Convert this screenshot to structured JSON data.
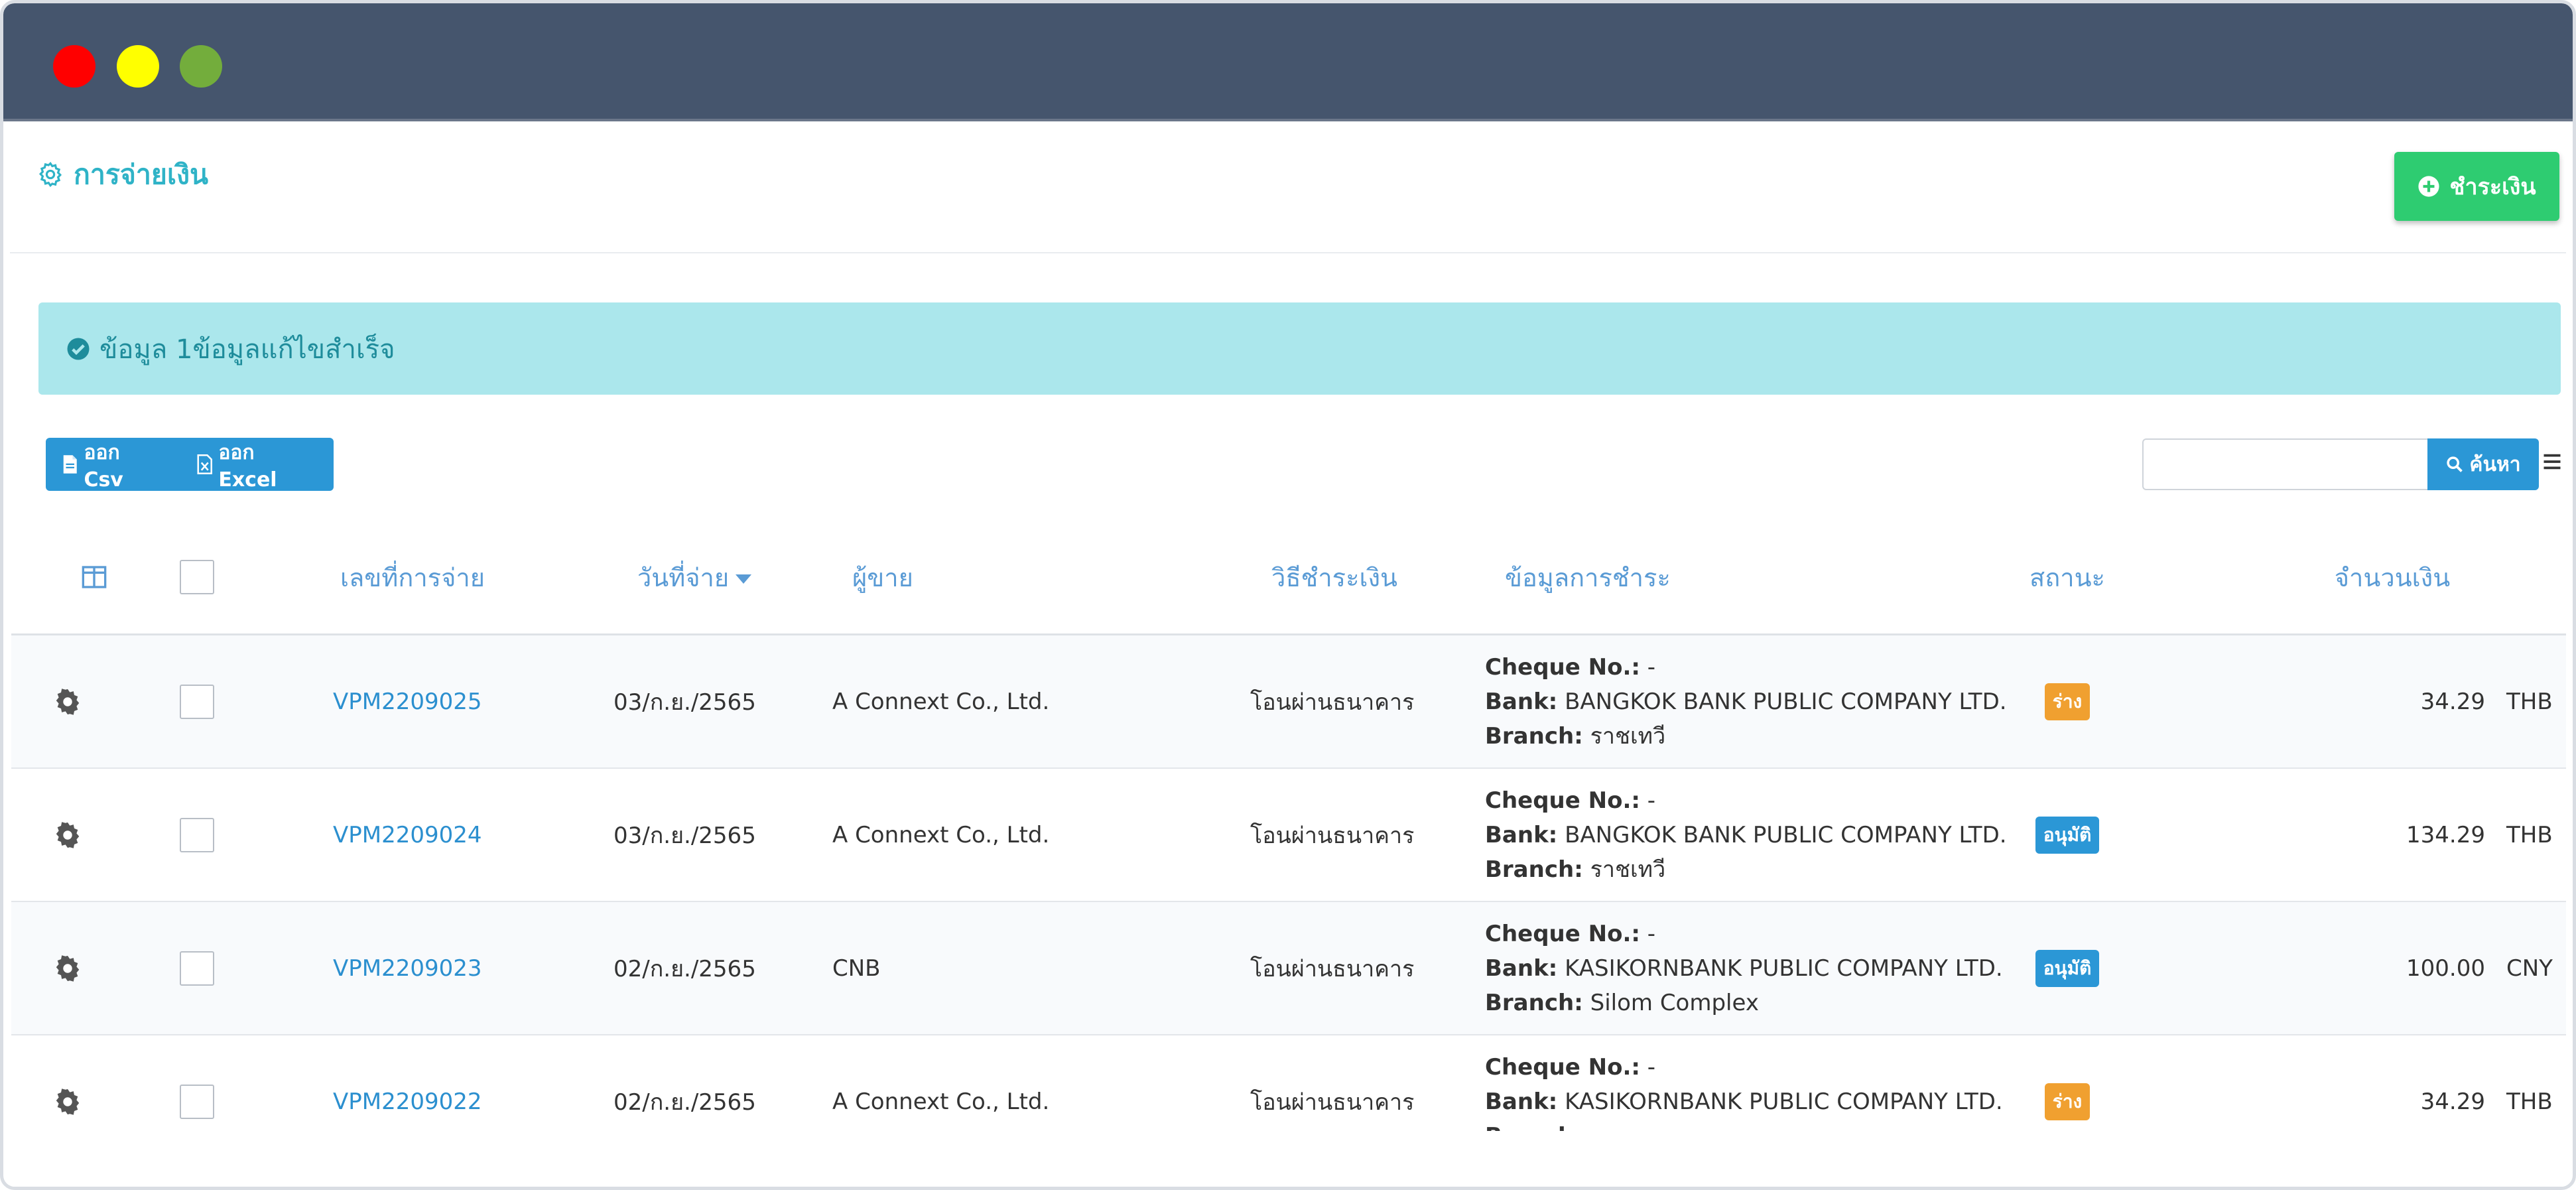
{
  "window": {
    "controls": [
      "close",
      "minimize",
      "maximize"
    ]
  },
  "header": {
    "title": "การจ่ายเงิน",
    "title_icon": "gear-icon",
    "pay_button_label": "ชำระเงิน",
    "pay_button_icon": "plus-circle-icon"
  },
  "alert": {
    "icon": "check-circle-icon",
    "message": "ข้อมูล 1ข้อมูลแก้ไขสำเร็จ"
  },
  "toolbar": {
    "export_csv_label": "ออก Csv",
    "export_excel_label": "ออก Excel",
    "search_placeholder": "",
    "search_value": "",
    "search_button_label": "ค้นหา"
  },
  "table": {
    "columns": {
      "doc_no": "เลขที่การจ่าย",
      "date": "วันที่จ่าย",
      "vendor": "ผู้ขาย",
      "method": "วิธีชำระเงิน",
      "payment_info": "ข้อมูลการชำระ",
      "status": "สถานะ",
      "amount": "จำนวนเงิน"
    },
    "sorted_column": "date",
    "info_labels": {
      "cheque": "Cheque No.:",
      "bank": "Bank:",
      "branch": "Branch:"
    },
    "rows": [
      {
        "doc_no": "VPM2209025",
        "date": "03/ก.ย./2565",
        "vendor": "A Connext Co., Ltd.",
        "method": "โอนผ่านธนาคาร",
        "cheque": "-",
        "bank": "BANGKOK BANK PUBLIC COMPANY LTD.",
        "branch": "ราชเทวี",
        "status": "ร่าง",
        "status_type": "draft",
        "amount": "34.29",
        "currency": "THB"
      },
      {
        "doc_no": "VPM2209024",
        "date": "03/ก.ย./2565",
        "vendor": "A Connext Co., Ltd.",
        "method": "โอนผ่านธนาคาร",
        "cheque": "-",
        "bank": "BANGKOK BANK PUBLIC COMPANY LTD.",
        "branch": "ราชเทวี",
        "status": "อนุมัติ",
        "status_type": "approved",
        "amount": "134.29",
        "currency": "THB"
      },
      {
        "doc_no": "VPM2209023",
        "date": "02/ก.ย./2565",
        "vendor": "CNB",
        "method": "โอนผ่านธนาคาร",
        "cheque": "-",
        "bank": "KASIKORNBANK PUBLIC COMPANY LTD.",
        "branch": "Silom Complex",
        "status": "อนุมัติ",
        "status_type": "approved",
        "amount": "100.00",
        "currency": "CNY"
      },
      {
        "doc_no": "VPM2209022",
        "date": "02/ก.ย./2565",
        "vendor": "A Connext Co., Ltd.",
        "method": "โอนผ่านธนาคาร",
        "cheque": "-",
        "bank": "KASIKORNBANK PUBLIC COMPANY LTD.",
        "branch": "",
        "status": "ร่าง",
        "status_type": "draft",
        "amount": "34.29",
        "currency": "THB"
      }
    ]
  },
  "colors": {
    "titlebar": "#45556d",
    "accent": "#2fb3c7",
    "primary": "#2b97d6",
    "success": "#2ecc71",
    "alert_bg": "#abe7ec",
    "draft": "#f0a030"
  }
}
